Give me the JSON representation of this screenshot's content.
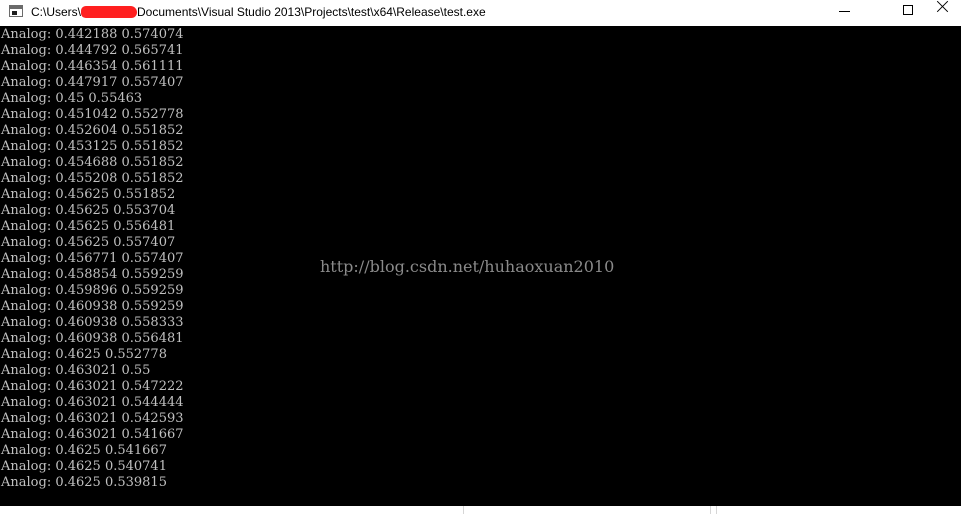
{
  "window": {
    "title_prefix": "C:\\Users\\",
    "title_suffix": "Documents\\Visual Studio 2013\\Projects\\test\\x64\\Release\\test.exe",
    "colors": {
      "console_background": "#000000",
      "console_text": "#c0c0c0",
      "redaction": "#ff2020",
      "watermark": "#8a8a8a"
    },
    "icons": [
      "console-app-icon",
      "minimize-icon",
      "maximize-icon",
      "close-icon"
    ]
  },
  "console": {
    "lines": [
      "Analog: 0.442188 0.574074",
      "Analog: 0.444792 0.565741",
      "Analog: 0.446354 0.561111",
      "Analog: 0.447917 0.557407",
      "Analog: 0.45 0.55463",
      "Analog: 0.451042 0.552778",
      "Analog: 0.452604 0.551852",
      "Analog: 0.453125 0.551852",
      "Analog: 0.454688 0.551852",
      "Analog: 0.455208 0.551852",
      "Analog: 0.45625 0.551852",
      "Analog: 0.45625 0.553704",
      "Analog: 0.45625 0.556481",
      "Analog: 0.45625 0.557407",
      "Analog: 0.456771 0.557407",
      "Analog: 0.458854 0.559259",
      "Analog: 0.459896 0.559259",
      "Analog: 0.460938 0.559259",
      "Analog: 0.460938 0.558333",
      "Analog: 0.460938 0.556481",
      "Analog: 0.4625 0.552778",
      "Analog: 0.463021 0.55",
      "Analog: 0.463021 0.547222",
      "Analog: 0.463021 0.544444",
      "Analog: 0.463021 0.542593",
      "Analog: 0.463021 0.541667",
      "Analog: 0.4625 0.541667",
      "Analog: 0.4625 0.540741",
      "Analog: 0.4625 0.539815"
    ],
    "watermark": "http://blog.csdn.net/huhaoxuan2010"
  }
}
